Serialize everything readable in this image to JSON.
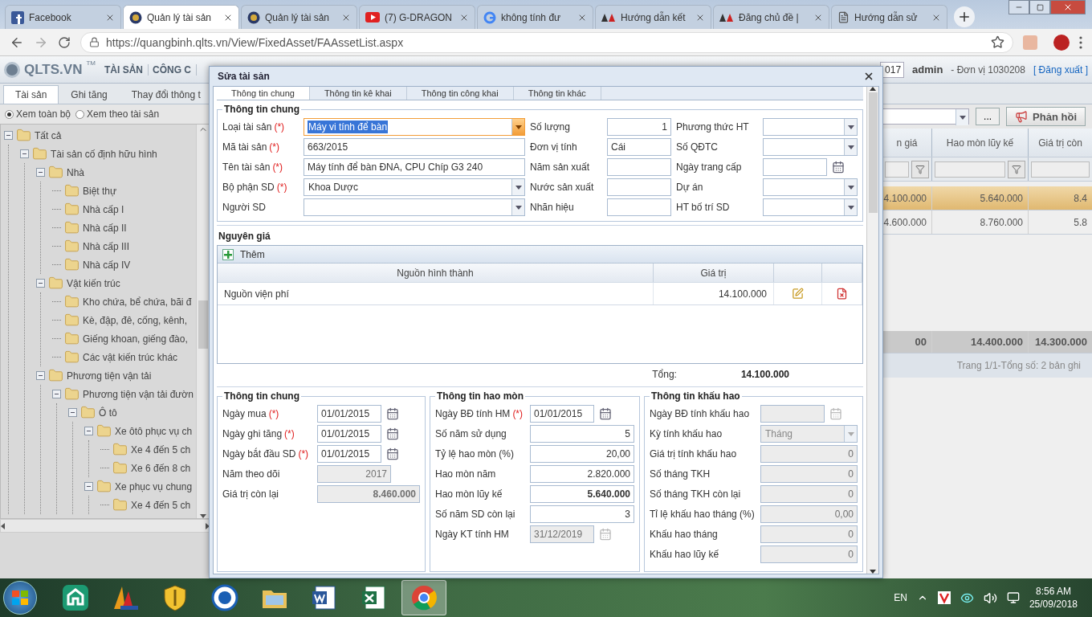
{
  "browser": {
    "tabs": [
      {
        "title": "Facebook",
        "kind": "social",
        "selected": false
      },
      {
        "title": "Quản lý tài sản",
        "kind": "app",
        "selected": true
      },
      {
        "title": "Quản lý tài sản",
        "kind": "app",
        "selected": false
      },
      {
        "title": "(7) G-DRAGON",
        "kind": "video",
        "selected": false
      },
      {
        "title": "không tính đư",
        "kind": "search",
        "selected": false
      },
      {
        "title": "Hướng dẫn kết",
        "kind": "forum",
        "selected": false
      },
      {
        "title": "Đăng chủ đề |",
        "kind": "forum",
        "selected": false
      },
      {
        "title": "Hướng dẫn sử",
        "kind": "page",
        "selected": false
      }
    ],
    "address": "https://quangbinh.qlts.vn/View/FixedAsset/FAAssetList.aspx"
  },
  "header": {
    "logo": "QLTS.VN",
    "logo_mark": "TM",
    "menu": [
      "TÀI SẢN",
      "CÔNG C"
    ],
    "year": "017",
    "user": "admin",
    "unit": "- Đơn vị 1030208",
    "logout": "[ Đăng xuất ]"
  },
  "nav_tabs": [
    {
      "label": "Tài sản",
      "selected": true
    },
    {
      "label": "Ghi tăng",
      "selected": false
    },
    {
      "label": "Thay đổi thông t",
      "selected": false
    }
  ],
  "view_options": [
    {
      "label": "Xem toàn bộ",
      "selected": true
    },
    {
      "label": "Xem theo tài sản",
      "selected": false
    }
  ],
  "tree": [
    {
      "label": "Tất cả",
      "expanded": true,
      "children": [
        {
          "label": "Tài sản cố định hữu hình",
          "expanded": true,
          "children": [
            {
              "label": "Nhà",
              "expanded": true,
              "children": [
                {
                  "label": "Biệt thự"
                },
                {
                  "label": "Nhà cấp I"
                },
                {
                  "label": "Nhà cấp II"
                },
                {
                  "label": "Nhà cấp III"
                },
                {
                  "label": "Nhà cấp IV"
                }
              ]
            },
            {
              "label": "Vật kiến trúc",
              "expanded": true,
              "children": [
                {
                  "label": "Kho chứa, bể chứa, bãi đ"
                },
                {
                  "label": "Kè, đập, đê, cống, kênh,"
                },
                {
                  "label": "Giếng khoan, giếng đào,"
                },
                {
                  "label": "Các vật kiến trúc khác"
                }
              ]
            },
            {
              "label": "Phương tiện vận tải",
              "expanded": true,
              "children": [
                {
                  "label": "Phương tiện vận tải đườn",
                  "expanded": true,
                  "children": [
                    {
                      "label": "Ô tô",
                      "expanded": true,
                      "children": [
                        {
                          "label": "Xe ôtô phục vụ ch",
                          "expanded": true,
                          "children": [
                            {
                              "label": "Xe 4 đến 5 ch"
                            },
                            {
                              "label": "Xe 6 đến 8 ch"
                            }
                          ]
                        },
                        {
                          "label": "Xe phục vụ chung",
                          "expanded": true,
                          "children": [
                            {
                              "label": "Xe 4 đến 5 ch"
                            }
                          ]
                        }
                      ]
                    }
                  ]
                }
              ]
            }
          ]
        }
      ]
    }
  ],
  "toolbar": {
    "browse": "...",
    "feedback": "Phản hồi"
  },
  "grid": {
    "columns": [
      "n giá",
      "Hao mòn lũy kế",
      "Giá trị còn"
    ],
    "rows": [
      {
        "cells": [
          "4.100.000",
          "5.640.000",
          "8.4"
        ],
        "selected": true
      },
      {
        "cells": [
          "4.600.000",
          "8.760.000",
          "5.8"
        ],
        "selected": false
      }
    ],
    "totals": [
      "00",
      "14.400.000",
      "14.300.000"
    ],
    "pager": "Trang 1/1-Tổng số: 2 bản ghi"
  },
  "dialog": {
    "title": "Sửa tài sản",
    "tabs": [
      {
        "label": "Thông tin chung",
        "selected": true
      },
      {
        "label": "Thông tin kê khai",
        "selected": false
      },
      {
        "label": "Thông tin công khai",
        "selected": false
      },
      {
        "label": "Thông tin khác",
        "selected": false
      }
    ],
    "general": {
      "title": "Thông tin chung",
      "fields": [
        {
          "label": "Loại tài sản",
          "required_mark": "(*)",
          "kind": "combo",
          "value": "Máy vi tính để bàn",
          "focused": true
        },
        {
          "label": "Số lượng",
          "kind": "number",
          "value": "1",
          "focused": false
        },
        {
          "label": "Phương thức HT",
          "kind": "combo",
          "focused": false
        },
        {
          "label": "Mã tài sản",
          "required_mark": "(*)",
          "kind": "text",
          "value": "663/2015",
          "focused": false
        },
        {
          "label": "Đơn vị tính",
          "kind": "text",
          "value": "Cái",
          "focused": false
        },
        {
          "label": "Số QĐTC",
          "kind": "combo",
          "focused": false
        },
        {
          "label": "Tên tài sản",
          "required_mark": "(*)",
          "kind": "text",
          "value": "Máy tính để bàn ĐNA, CPU Chíp G3 240",
          "focused": false
        },
        {
          "label": "Năm sản xuất",
          "kind": "text",
          "focused": false
        },
        {
          "label": "Ngày trang cấp",
          "kind": "date",
          "focused": false
        },
        {
          "label": "Bộ phận SD",
          "required_mark": "(*)",
          "kind": "combo",
          "value": "Khoa Dược",
          "focused": false
        },
        {
          "label": "Nước sản xuất",
          "kind": "text",
          "focused": false
        },
        {
          "label": "Dự án",
          "kind": "combo",
          "focused": false
        },
        {
          "label": "Người SD",
          "kind": "combo",
          "focused": false
        },
        {
          "label": "Nhãn hiệu",
          "kind": "text",
          "focused": false
        },
        {
          "label": "HT bố trí SD",
          "kind": "combo",
          "focused": false
        }
      ]
    },
    "cost": {
      "title": "Nguyên giá",
      "add": "Thêm",
      "columns": [
        "Nguồn hình thành",
        "Giá trị"
      ],
      "rows": [
        {
          "cells": [
            "Nguồn viện phí",
            "14.100.000"
          ]
        }
      ],
      "total_label": "Tổng:",
      "total": "14.100.000"
    },
    "groups": [
      {
        "title": "Thông tin chung",
        "fields": [
          {
            "label": "Ngày mua",
            "required_mark": "(*)",
            "kind": "date",
            "value": "01/01/2015",
            "disabled": false
          },
          {
            "label": "Ngày ghi tăng",
            "required_mark": "(*)",
            "kind": "date",
            "value": "01/01/2015",
            "disabled": false
          },
          {
            "label": "Ngày bắt đầu SD",
            "required_mark": "(*)",
            "kind": "date",
            "value": "01/01/2015",
            "disabled": false
          },
          {
            "label": "Năm theo dõi",
            "kind": "short",
            "value": "2017",
            "disabled": true
          },
          {
            "label": "Giá trị còn lại",
            "kind": "sum",
            "value": "8.460.000",
            "disabled": true
          }
        ]
      },
      {
        "title": "Thông tin hao mòn",
        "fields": [
          {
            "label": "Ngày BĐ tính HM",
            "required_mark": "(*)",
            "kind": "date",
            "value": "01/01/2015",
            "disabled": false
          },
          {
            "label": "Số năm sử dụng",
            "kind": "number",
            "value": "5",
            "disabled": false
          },
          {
            "label": "Tỷ lệ hao mòn (%)",
            "kind": "number",
            "value": "20,00",
            "disabled": false
          },
          {
            "label": "Hao mòn năm",
            "kind": "number",
            "value": "2.820.000",
            "disabled": false
          },
          {
            "label": "Hao mòn lũy kế",
            "kind": "sum",
            "value": "5.640.000",
            "disabled": false
          },
          {
            "label": "Số năm SD còn lại",
            "kind": "number",
            "value": "3",
            "disabled": false
          },
          {
            "label": "Ngày KT tính HM",
            "kind": "date",
            "value": "31/12/2019",
            "disabled": true
          }
        ]
      },
      {
        "title": "Thông tin khấu hao",
        "fields": [
          {
            "label": "Ngày BĐ tính khấu hao",
            "kind": "date",
            "disabled": true
          },
          {
            "label": "Kỳ tính khấu hao",
            "kind": "combo",
            "value": "Tháng",
            "disabled": true
          },
          {
            "label": "Giá trị tính khấu hao",
            "kind": "number",
            "value": "0",
            "disabled": true
          },
          {
            "label": "Số tháng TKH",
            "kind": "number",
            "value": "0",
            "disabled": true
          },
          {
            "label": "Số tháng TKH còn lại",
            "kind": "number",
            "value": "0",
            "disabled": true
          },
          {
            "label": "Tỉ lệ khấu hao tháng (%)",
            "kind": "number",
            "value": "0,00",
            "disabled": true
          },
          {
            "label": "Khấu hao tháng",
            "kind": "number",
            "value": "0",
            "disabled": true
          },
          {
            "label": "Khấu hao lũy kế",
            "kind": "number",
            "value": "0",
            "disabled": true
          }
        ]
      }
    ]
  },
  "taskbar": {
    "apps": [
      {
        "selected": false
      },
      {
        "selected": false
      },
      {
        "selected": false
      },
      {
        "selected": false
      },
      {
        "selected": false
      },
      {
        "selected": false
      },
      {
        "selected": false
      },
      {
        "selected": true
      }
    ],
    "language": "EN",
    "time": "8:56 AM",
    "date": "25/09/2018"
  }
}
